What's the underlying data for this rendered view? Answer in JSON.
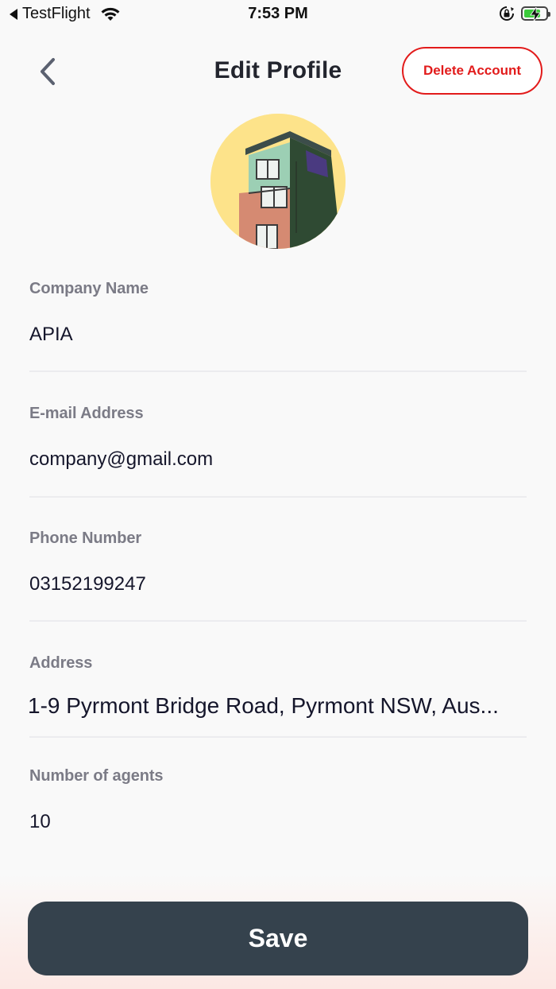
{
  "status_bar": {
    "app_name": "TestFlight",
    "time": "7:53 PM",
    "battery_level": 0.75,
    "icons": [
      "back-arrow-icon",
      "wifi-icon",
      "orientation-lock-icon",
      "battery-charging-icon"
    ]
  },
  "header": {
    "title": "Edit Profile",
    "back_icon": "chevron-left-icon",
    "delete_label": "Delete Account"
  },
  "avatar": {
    "description_icon": "building-photo"
  },
  "fields": {
    "company_name": {
      "label": "Company Name",
      "value": "APIA"
    },
    "email": {
      "label": "E-mail Address",
      "value": "company@gmail.com"
    },
    "phone": {
      "label": "Phone Number",
      "value": "03152199247"
    },
    "address": {
      "label": "Address",
      "value": "1-9 Pyrmont Bridge Road, Pyrmont NSW, Aus..."
    },
    "agents": {
      "label": "Number of agents",
      "value": "10"
    }
  },
  "save_label": "Save",
  "colors": {
    "accent_delete": "#e21b1b",
    "save_bg": "#35424d",
    "background": "#f9f9f9"
  }
}
